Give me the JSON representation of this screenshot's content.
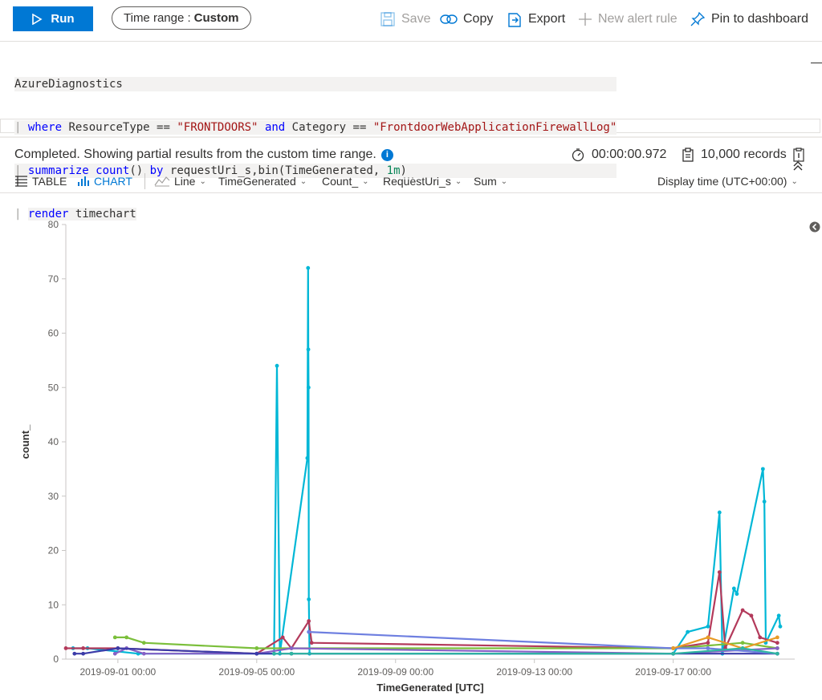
{
  "toolbar": {
    "run_label": "Run",
    "time_range_label": "Time range :",
    "time_range_value": "Custom",
    "save_label": "Save",
    "copy_label": "Copy",
    "export_label": "Export",
    "new_alert_label": "New alert rule",
    "pin_label": "Pin to dashboard"
  },
  "query": {
    "line1": "AzureDiagnostics",
    "line2_where": "where",
    "line2_a": "ResourceType ==",
    "line2_str1": "\"FRONTDOORS\"",
    "line2_and": "and",
    "line2_b": "Category ==",
    "line2_str2": "\"FrontdoorWebApplicationFirewallLog\"",
    "line3_summarize": "summarize",
    "line3_count": "count",
    "line3_a": "()",
    "line3_by": "by",
    "line3_b": "requestUri_s,bin(TimeGenerated,",
    "line3_num": "1m",
    "line3_c": ")",
    "line4_render": "render",
    "line4_b": "timechart",
    "pipe": "|"
  },
  "status": {
    "message": "Completed. Showing partial results from the custom time range.",
    "duration": "00:00:00.972",
    "records": "10,000 records"
  },
  "results_toolbar": {
    "table_label": "TABLE",
    "chart_label": "CHART",
    "chart_type": "Line",
    "x_column": "TimeGenerated",
    "y_column": "Count_",
    "split_column": "RequestUri_s",
    "aggregation": "Sum",
    "display_time": "Display time (UTC+00:00)"
  },
  "colors": {
    "accent": "#0078d4",
    "cyan": "#00b7d6",
    "crimson": "#b33a5b",
    "green": "#7bbf3b",
    "purple": "#8661c5",
    "indigo": "#3b3ba8",
    "blue": "#6e7fe0",
    "orange": "#e89b26",
    "teal": "#2fb5a1"
  },
  "chart_data": {
    "type": "line",
    "title": "",
    "xlabel": "TimeGenerated [UTC]",
    "ylabel": "count_",
    "x_ticks": [
      "2019-09-01 00:00",
      "2019-09-05 00:00",
      "2019-09-09 00:00",
      "2019-09-13 00:00",
      "2019-09-17 00:00"
    ],
    "y_ticks": [
      0,
      10,
      20,
      30,
      40,
      50,
      60,
      70,
      80
    ],
    "ylim": [
      0,
      80
    ],
    "xlim": [
      "2019-08-30 12:00",
      "2019-09-20 12:00"
    ],
    "grid": false,
    "series": [
      {
        "color": "#00b7d6",
        "points": [
          [
            "2019-08-30 17:00",
            2
          ],
          [
            "2019-08-31 03:00",
            2
          ],
          [
            "2019-09-01 14:00",
            1
          ],
          [
            "2019-09-05 00:00",
            1
          ],
          [
            "2019-09-05 12:00",
            1
          ],
          [
            "2019-09-05 14:00",
            54
          ],
          [
            "2019-09-05 16:00",
            1
          ],
          [
            "2019-09-06 11:00",
            37
          ],
          [
            "2019-09-06 11:30",
            72
          ],
          [
            "2019-09-06 11:40",
            57
          ],
          [
            "2019-09-06 11:50",
            50
          ],
          [
            "2019-09-06 12:00",
            11
          ],
          [
            "2019-09-06 12:30",
            1
          ],
          [
            "2019-09-17 00:00",
            1
          ],
          [
            "2019-09-17 10:00",
            5
          ],
          [
            "2019-09-18 00:00",
            6
          ],
          [
            "2019-09-18 08:00",
            27
          ],
          [
            "2019-09-18 10:00",
            1
          ],
          [
            "2019-09-18 18:00",
            13
          ],
          [
            "2019-09-18 20:00",
            12
          ],
          [
            "2019-09-19 14:00",
            35
          ],
          [
            "2019-09-19 15:00",
            29
          ],
          [
            "2019-09-19 16:00",
            3
          ],
          [
            "2019-09-20 01:00",
            8
          ],
          [
            "2019-09-20 02:00",
            6
          ]
        ]
      },
      {
        "color": "#b33a5b",
        "points": [
          [
            "2019-08-30 12:00",
            2
          ],
          [
            "2019-08-31 00:00",
            2
          ],
          [
            "2019-09-01 00:00",
            2
          ],
          [
            "2019-09-05 00:00",
            1
          ],
          [
            "2019-09-05 18:00",
            4
          ],
          [
            "2019-09-06 00:00",
            2
          ],
          [
            "2019-09-06 12:00",
            7
          ],
          [
            "2019-09-06 14:00",
            3
          ],
          [
            "2019-09-17 00:00",
            2
          ],
          [
            "2019-09-18 00:00",
            3
          ],
          [
            "2019-09-18 08:00",
            16
          ],
          [
            "2019-09-18 12:00",
            2
          ],
          [
            "2019-09-19 00:00",
            9
          ],
          [
            "2019-09-19 06:00",
            8
          ],
          [
            "2019-09-19 12:00",
            4
          ],
          [
            "2019-09-20 00:00",
            3
          ]
        ]
      },
      {
        "color": "#7bbf3b",
        "points": [
          [
            "2019-08-31 22:00",
            4
          ],
          [
            "2019-09-01 06:00",
            4
          ],
          [
            "2019-09-01 18:00",
            3
          ],
          [
            "2019-09-05 00:00",
            2
          ],
          [
            "2019-09-06 00:00",
            2
          ],
          [
            "2019-09-17 00:00",
            2
          ],
          [
            "2019-09-19 00:00",
            3
          ],
          [
            "2019-09-20 00:00",
            2
          ]
        ]
      },
      {
        "color": "#8661c5",
        "points": [
          [
            "2019-08-31 22:00",
            1
          ],
          [
            "2019-09-01 06:00",
            2
          ],
          [
            "2019-09-01 18:00",
            1
          ],
          [
            "2019-09-05 00:00",
            1
          ],
          [
            "2019-09-06 00:00",
            2
          ],
          [
            "2019-09-17 00:00",
            1
          ],
          [
            "2019-09-20 00:00",
            2
          ]
        ]
      },
      {
        "color": "#3b3ba8",
        "points": [
          [
            "2019-08-30 18:00",
            1
          ],
          [
            "2019-08-31 00:00",
            1
          ],
          [
            "2019-09-01 00:00",
            2
          ],
          [
            "2019-09-05 00:00",
            1
          ],
          [
            "2019-09-06 00:00",
            1
          ],
          [
            "2019-09-17 00:00",
            1
          ],
          [
            "2019-09-20 00:00",
            1
          ]
        ]
      },
      {
        "color": "#6e7fe0",
        "points": [
          [
            "2019-09-06 12:00",
            5
          ],
          [
            "2019-09-17 00:00",
            2
          ],
          [
            "2019-09-18 00:00",
            2
          ],
          [
            "2019-09-20 00:00",
            1
          ]
        ]
      },
      {
        "color": "#e89b26",
        "points": [
          [
            "2019-09-17 00:00",
            2
          ],
          [
            "2019-09-18 00:00",
            4
          ],
          [
            "2019-09-19 00:00",
            2
          ],
          [
            "2019-09-20 00:00",
            4
          ]
        ]
      },
      {
        "color": "#2fb5a1",
        "points": [
          [
            "2019-09-05 12:00",
            1
          ],
          [
            "2019-09-06 00:00",
            1
          ],
          [
            "2019-09-17 00:00",
            1
          ],
          [
            "2019-09-19 00:00",
            2
          ],
          [
            "2019-09-20 00:00",
            1
          ]
        ]
      }
    ]
  }
}
